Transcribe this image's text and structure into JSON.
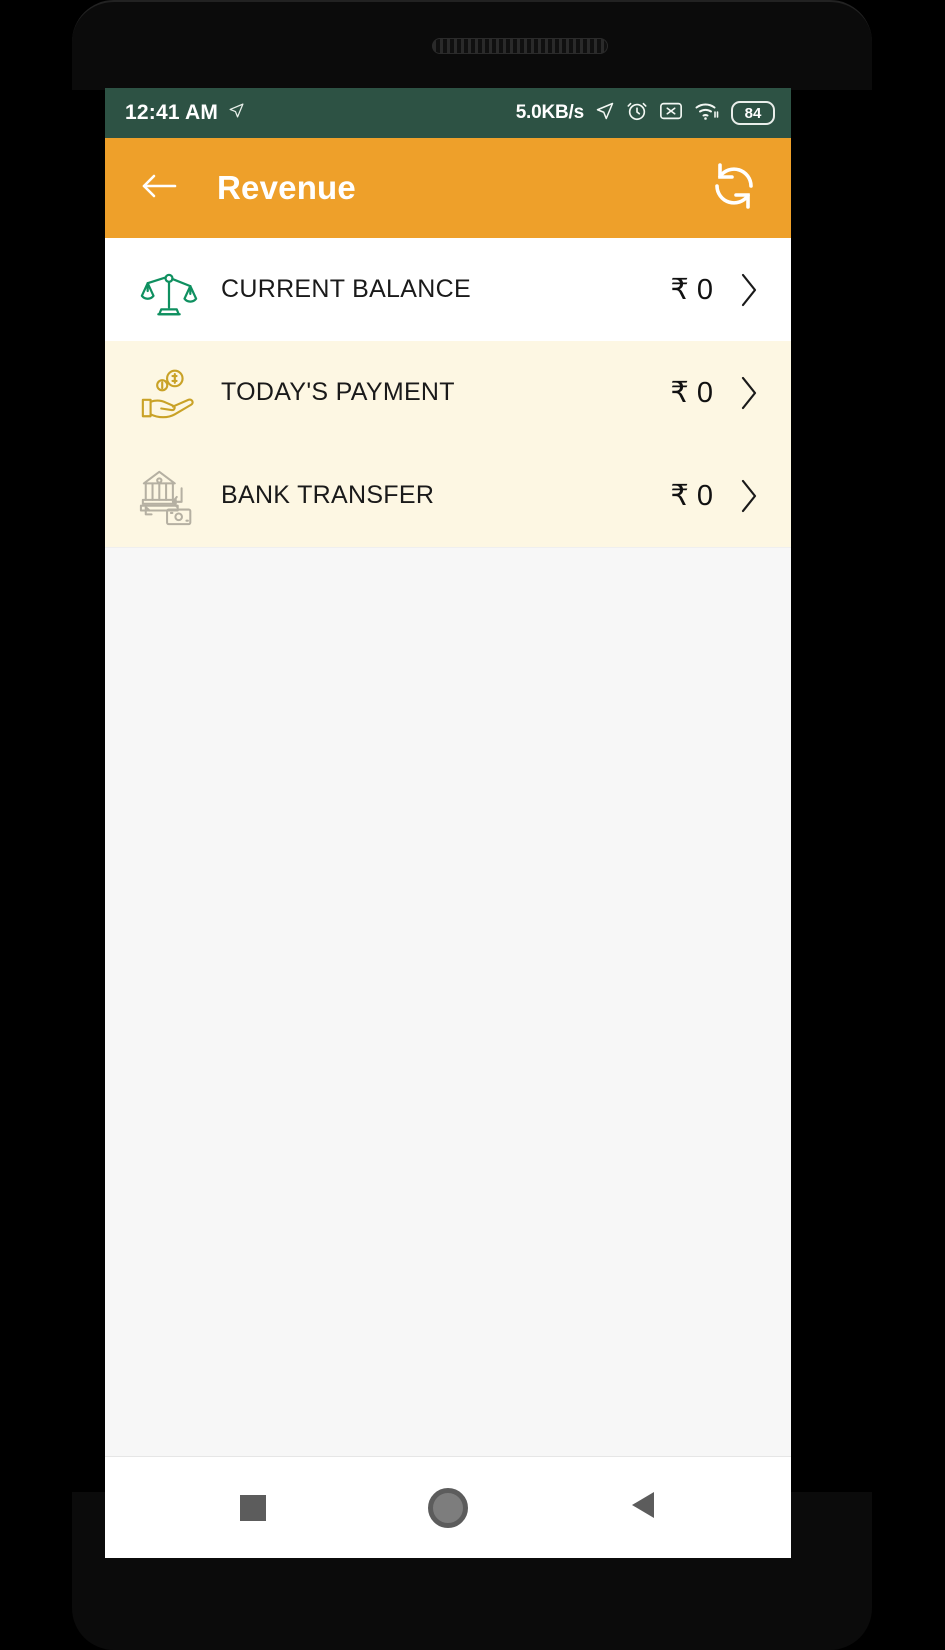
{
  "status_bar": {
    "time": "12:41 AM",
    "location_icon": "location-arrow-icon",
    "network_speed": "5.0KB/s",
    "icons": [
      "location-arrow-icon",
      "alarm-clock-icon",
      "sim-disabled-icon",
      "wifi-icon"
    ],
    "battery_level": "84",
    "background_color": "#2d5244"
  },
  "app_bar": {
    "title": "Revenue",
    "back_icon": "arrow-left-icon",
    "refresh_icon": "refresh-sync-icon",
    "background_color": "#eea02a",
    "text_color": "#ffffff"
  },
  "list": {
    "rows": [
      {
        "label": "CURRENT BALANCE",
        "amount": "₹ 0",
        "icon": "balance-scale-icon",
        "icon_color": "#0f9060",
        "row_background": "#ffffff",
        "chevron": "chevron-right-icon"
      },
      {
        "label": "TODAY'S PAYMENT",
        "amount": "₹ 0",
        "icon": "hand-with-coins-icon",
        "icon_color": "#c9a227",
        "row_background": "#fdf7e3",
        "chevron": "chevron-right-icon"
      },
      {
        "label": "BANK TRANSFER",
        "amount": "₹ 0",
        "icon": "bank-transfer-icon",
        "icon_color": "#b5b0a2",
        "row_background": "#fdf7e3",
        "chevron": "chevron-right-icon"
      }
    ]
  },
  "nav_bar": {
    "recents_label": "recents",
    "home_label": "home",
    "back_label": "back",
    "icon_color": "#5c5c5c"
  }
}
